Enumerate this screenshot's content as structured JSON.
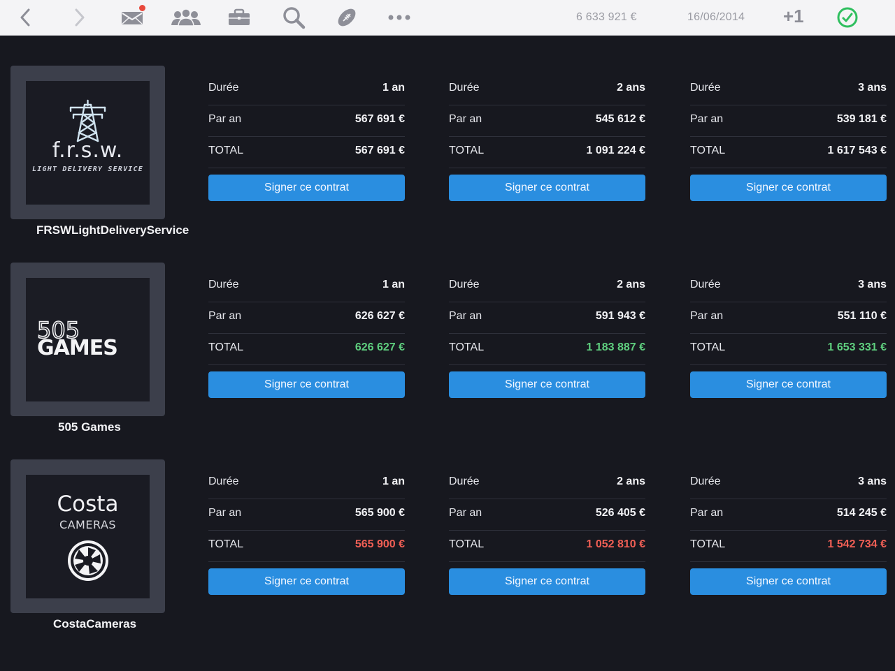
{
  "toolbar": {
    "balance": "6 633 921 €",
    "date": "16/06/2014",
    "plus_label": "+1"
  },
  "companies": [
    {
      "name": "FRSWLightDeliveryService",
      "logo": {
        "main": "f.r.s.w.",
        "sub": "LIGHT DELIVERY SERVICE"
      },
      "offers": [
        {
          "duration_label": "Durée",
          "duration": "1 an",
          "per_year_label": "Par an",
          "per_year": "567 691 €",
          "total_label": "TOTAL",
          "total": "567 691 €",
          "button": "Signer ce contrat"
        },
        {
          "duration_label": "Durée",
          "duration": "2 ans",
          "per_year_label": "Par an",
          "per_year": "545 612 €",
          "total_label": "TOTAL",
          "total": "1 091 224 €",
          "button": "Signer ce contrat"
        },
        {
          "duration_label": "Durée",
          "duration": "3 ans",
          "per_year_label": "Par an",
          "per_year": "539 181 €",
          "total_label": "TOTAL",
          "total": "1 617 543 €",
          "button": "Signer ce contrat"
        }
      ]
    },
    {
      "name": "505 Games",
      "logo": {
        "top": "505",
        "bottom": "GAMES"
      },
      "offers": [
        {
          "duration_label": "Durée",
          "duration": "1 an",
          "per_year_label": "Par an",
          "per_year": "626 627 €",
          "total_label": "TOTAL",
          "total": "626 627 €",
          "button": "Signer ce contrat"
        },
        {
          "duration_label": "Durée",
          "duration": "2 ans",
          "per_year_label": "Par an",
          "per_year": "591 943 €",
          "total_label": "TOTAL",
          "total": "1 183 887 €",
          "button": "Signer ce contrat"
        },
        {
          "duration_label": "Durée",
          "duration": "3 ans",
          "per_year_label": "Par an",
          "per_year": "551 110 €",
          "total_label": "TOTAL",
          "total": "1 653 331 €",
          "button": "Signer ce contrat"
        }
      ]
    },
    {
      "name": "CostaCameras",
      "logo": {
        "top": "Costa",
        "mid": "CAMERAS"
      },
      "offers": [
        {
          "duration_label": "Durée",
          "duration": "1 an",
          "per_year_label": "Par an",
          "per_year": "565 900 €",
          "total_label": "TOTAL",
          "total": "565 900 €",
          "button": "Signer ce contrat"
        },
        {
          "duration_label": "Durée",
          "duration": "2 ans",
          "per_year_label": "Par an",
          "per_year": "526 405 €",
          "total_label": "TOTAL",
          "total": "1 052 810 €",
          "button": "Signer ce contrat"
        },
        {
          "duration_label": "Durée",
          "duration": "3 ans",
          "per_year_label": "Par an",
          "per_year": "514 245 €",
          "total_label": "TOTAL",
          "total": "1 542 734 €",
          "button": "Signer ce contrat"
        }
      ]
    }
  ],
  "colors": {
    "total_positive": "#5fcf7f",
    "total_negative": "#f15f55",
    "button": "#2a8ee0",
    "clock_icon": "#2fbf5f"
  },
  "icons": [
    "back-arrow-icon",
    "forward-arrow-icon",
    "mail-icon",
    "team-icon",
    "briefcase-icon",
    "search-icon",
    "football-icon",
    "more-icon",
    "clock-icon"
  ]
}
